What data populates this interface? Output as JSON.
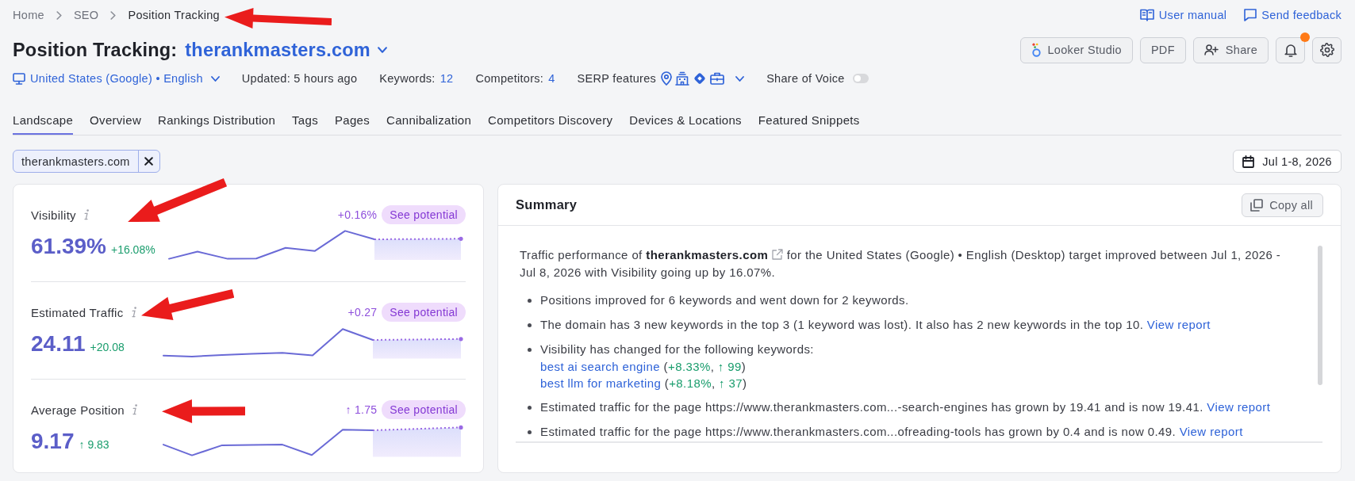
{
  "breadcrumb": [
    {
      "label": "Home",
      "current": false,
      "annotated": false
    },
    {
      "label": "SEO",
      "current": false,
      "annotated": false
    },
    {
      "label": "Position Tracking",
      "current": true,
      "annotated": true
    }
  ],
  "help_links": [
    {
      "kind": "manual",
      "label": "User manual"
    },
    {
      "kind": "feedback",
      "label": "Send feedback"
    }
  ],
  "title": {
    "label": "Position Tracking:",
    "project": "therankmasters.com"
  },
  "toolbar": [
    {
      "kind": "studio",
      "label": "Looker Studio"
    },
    {
      "kind": "pdf",
      "label": "PDF"
    },
    {
      "kind": "share",
      "label": "Share"
    },
    {
      "kind": "notifications",
      "has_notification": true
    },
    {
      "kind": "settings"
    }
  ],
  "filters": {
    "location": "United States (Google) • English",
    "updated": "Updated: 5 hours ago",
    "keywords_label": "Keywords:",
    "keywords_count": "12",
    "competitors_label": "Competitors:",
    "competitors_count": "4",
    "serp_label": "SERP features",
    "share_of_voice": {
      "label": "Share of Voice",
      "on": false
    }
  },
  "tabs": [
    {
      "label": "Landscape",
      "selected": true
    },
    {
      "label": "Overview",
      "selected": false
    },
    {
      "label": "Rankings Distribution",
      "selected": false
    },
    {
      "label": "Tags",
      "selected": false
    },
    {
      "label": "Pages",
      "selected": false
    },
    {
      "label": "Cannibalization",
      "selected": false
    },
    {
      "label": "Competitors Discovery",
      "selected": false
    },
    {
      "label": "Devices & Locations",
      "selected": false
    },
    {
      "label": "Featured Snippets",
      "selected": false
    }
  ],
  "domain_chip": {
    "label": "therankmasters.com"
  },
  "date_range": {
    "label": "Jul 1-8, 2026"
  },
  "metrics": [
    {
      "label": "Visibility",
      "value": "61.39%",
      "change": "+16.08%",
      "potential": "+0.16%",
      "potential_button": "See potential",
      "annotated": true
    },
    {
      "label": "Estimated Traffic",
      "value": "24.11",
      "change": "+20.08",
      "potential": "+0.27",
      "potential_button": "See potential",
      "annotated": true
    },
    {
      "label": "Average Position",
      "value": "9.17",
      "change": "↑ 9.83",
      "potential": "↑ 1.75",
      "potential_button": "See potential",
      "annotated": true
    }
  ],
  "summary": {
    "title": "Summary",
    "copy_button": "Copy all",
    "intro": {
      "before": "Traffic performance of",
      "domain": "therankmasters.com",
      "after": "for the United States (Google) • English (Desktop) target improved between Jul 1, 2026 - Jul 8, 2026 with Visibility going up by 16.07%."
    },
    "items": [
      {
        "text": "Positions improved for 6 keywords and went down for 2 keywords."
      },
      {
        "text": "The domain has 3 new keywords in the top 3 (1 keyword was lost). It also has 2 new keywords in the top 10.",
        "link": "View report"
      },
      {
        "text": "Visibility has changed for the following keywords:",
        "keywords": [
          {
            "keyword": "best ai search engine",
            "parts": [
              {
                "kind": "plain",
                "text": "("
              },
              {
                "kind": "up",
                "text": "+8.33%"
              },
              {
                "kind": "plain",
                "text": ", "
              },
              {
                "kind": "up",
                "text": "↑ 99"
              },
              {
                "kind": "plain",
                "text": ")"
              }
            ]
          },
          {
            "keyword": "best llm for marketing",
            "parts": [
              {
                "kind": "plain",
                "text": "("
              },
              {
                "kind": "up",
                "text": "+8.18%"
              },
              {
                "kind": "plain",
                "text": ", "
              },
              {
                "kind": "up",
                "text": "↑ 37"
              },
              {
                "kind": "plain",
                "text": ")"
              }
            ]
          }
        ]
      },
      {
        "text": "Estimated traffic for the page https://www.therankmasters.com...-search-engines has grown by 19.41 and is now 19.41.",
        "link": "View report"
      },
      {
        "text": "Estimated traffic for the page https://www.therankmasters.com...ofreading-tools has grown by 0.4 and is now 0.49.",
        "link": "View report"
      }
    ]
  }
}
